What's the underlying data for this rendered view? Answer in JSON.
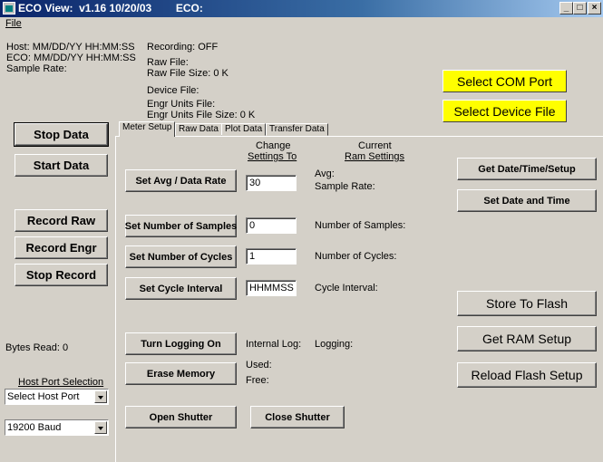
{
  "window": {
    "title": "ECO View:  v1.16 10/20/03        ECO:",
    "min": "_",
    "max": "□",
    "close": "×"
  },
  "menu": {
    "file": "File"
  },
  "status": {
    "host": "Host: MM/DD/YY HH:MM:SS",
    "eco": "ECO:  MM/DD/YY HH:MM:SS",
    "sample_rate": "Sample Rate:",
    "recording": "Recording:  OFF",
    "raw_file": "Raw File:",
    "raw_file_size": "Raw File Size: 0 K",
    "device_file": "Device File:",
    "engr_file": "Engr Units File:",
    "engr_file_size": "Engr Units File Size: 0 K"
  },
  "yellow": {
    "com_port": "Select COM Port",
    "device_file": "Select Device File"
  },
  "left_buttons": {
    "stop_data": "Stop Data",
    "start_data": "Start Data",
    "record_raw": "Record  Raw",
    "record_engr": "Record Engr",
    "stop_record": "Stop Record"
  },
  "bytes_read": "Bytes Read: 0",
  "host_port": {
    "label": "Host Port Selection",
    "port_value": "Select Host Port",
    "baud_value": "19200 Baud"
  },
  "tabs": [
    "Meter Setup",
    "Raw Data",
    "Plot Data",
    "Transfer Data"
  ],
  "columns": {
    "change_1": "Change",
    "change_2": "Settings To",
    "current_1": "Current",
    "current_2": "Ram Settings"
  },
  "setup": {
    "avg_button": "Set Avg / Data Rate",
    "avg_value": "30",
    "avg_label": "Avg:",
    "sample_rate_label": "Sample Rate:",
    "samples_button": "Set Number of Samples",
    "samples_value": "0",
    "samples_label": "Number of Samples:",
    "cycles_button": "Set Number of Cycles",
    "cycles_value": "1",
    "cycles_label": "Number of Cycles:",
    "interval_button": "Set Cycle Interval",
    "interval_value": "HHMMSS",
    "interval_label": "Cycle Interval:",
    "logging_button": "Turn Logging On",
    "internal_log": "Internal Log:",
    "logging_label": "Logging:",
    "erase_button": "Erase Memory",
    "used_label": "Used:",
    "free_label": "Free:",
    "open_shutter": "Open Shutter",
    "close_shutter": "Close Shutter"
  },
  "right_buttons": {
    "get_date": "Get Date/Time/Setup",
    "set_date": "Set Date and Time",
    "store_flash": "Store To Flash",
    "get_ram": "Get RAM Setup",
    "reload_flash": "Reload Flash Setup"
  }
}
